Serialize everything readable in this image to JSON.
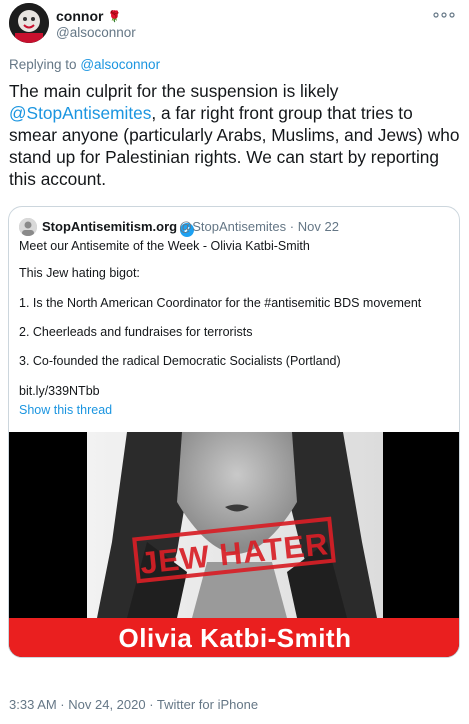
{
  "author": {
    "name": "connor",
    "handle": "@alsoconnor",
    "more_icon": "ellipsis-icon",
    "rose_icon": "rose-icon"
  },
  "reply": {
    "prefix": "Replying to",
    "target": "@alsoconnor"
  },
  "tweet": {
    "text_1": "The main culprit for the suspension is likely",
    "mention": "@StopAntisemites",
    "text_2": ", a far right front group that tries to smear anyone (particularly Arabs, Muslims, and Jews) who stand up for Palestinian rights. We can start by reporting this account."
  },
  "quote": {
    "name": "StopAntisemitism.org",
    "handle": "@StopAntisemites",
    "dot": "·",
    "date": "Nov 22",
    "lines": [
      "Meet our Antisemite of the Week - Olivia Katbi-Smith",
      "This Jew hating bigot:",
      "1. Is the North American Coordinator for the #antisemitic BDS movement",
      "2. Cheerleads and fundraises for terrorists",
      "3. Co-founded the radical Democratic Socialists (Portland)",
      "bit.ly/339NTbb"
    ],
    "show_thread": "Show this thread",
    "image": {
      "stamp": "JEW HATER",
      "banner": "Olivia Katbi-Smith"
    }
  },
  "footer": {
    "time": "3:33 AM · Nov 24, 2020 · Twitter for iPhone"
  }
}
